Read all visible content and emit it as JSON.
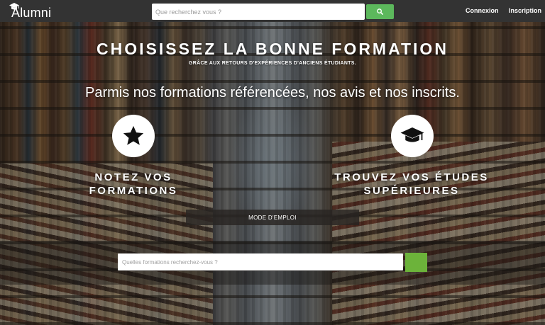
{
  "navbar": {
    "logo_text": "Alumni",
    "search_placeholder": "Que recherchez vous ?",
    "login_label": "Connexion",
    "signup_label": "Inscription",
    "search_icon": "search-icon",
    "logo_icon": "graduation-cap-icon"
  },
  "hero": {
    "title": "CHOISISSEZ LA BONNE FORMATION",
    "subtitle": "GRÂCE AUX RETOURS D'EXPÉRIENCES D'ANCIENS ÉTUDIANTS.",
    "tagline": "Parmis nos formations référencées, nos avis et nos inscrits."
  },
  "features": {
    "left": {
      "icon": "star-icon",
      "line1": "NOTEZ VOS",
      "line2": "FORMATIONS"
    },
    "right": {
      "icon": "graduation-cap-icon",
      "line1": "TROUVEZ VOS ÉTUDES",
      "line2": "SUPÉRIEURES"
    }
  },
  "howto": {
    "label": "MODE D'EMPLOI"
  },
  "main_search": {
    "placeholder": "Quelles formations recherchez-vous ?"
  },
  "colors": {
    "navbar": "#333333",
    "accent_green": "#5cb85c",
    "search_btn_green": "#6cb33a"
  }
}
